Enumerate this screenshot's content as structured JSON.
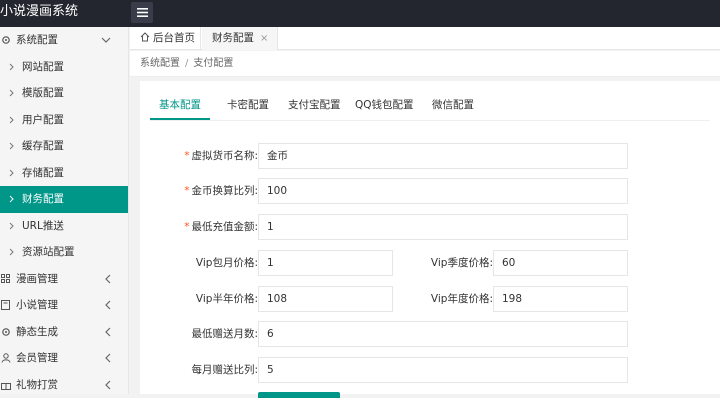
{
  "app": {
    "title": "小说漫画系统"
  },
  "sidebar": {
    "group_open": "系统配置",
    "subitems": [
      {
        "label": "网站配置"
      },
      {
        "label": "模版配置"
      },
      {
        "label": "用户配置"
      },
      {
        "label": "缓存配置"
      },
      {
        "label": "存储配置"
      },
      {
        "label": "财务配置"
      },
      {
        "label": "URL推送"
      },
      {
        "label": "资源站配置"
      }
    ],
    "groups": [
      {
        "label": "漫画管理"
      },
      {
        "label": "小说管理"
      },
      {
        "label": "静态生成"
      },
      {
        "label": "会员管理"
      },
      {
        "label": "礼物打赏"
      }
    ]
  },
  "tabs": {
    "home": "后台首页",
    "current": "财务配置",
    "close_glyph": "×"
  },
  "breadcrumb": {
    "parent": "系统配置",
    "separator": "/",
    "current": "支付配置"
  },
  "subtabs": [
    "基本配置",
    "卡密配置",
    "支付宝配置",
    "QQ钱包配置",
    "微信配置"
  ],
  "form": {
    "currency_name": {
      "label": "虚拟货币名称:",
      "value": "金币"
    },
    "exchange_ratio": {
      "label": "金币换算比列:",
      "value": "100"
    },
    "min_recharge": {
      "label": "最低充值金额:",
      "value": "1"
    },
    "vip_month": {
      "label": "Vip包月价格:",
      "value": "1"
    },
    "vip_quarter": {
      "label": "Vip季度价格:",
      "value": "60"
    },
    "vip_half_year": {
      "label": "Vip半年价格:",
      "value": "108"
    },
    "vip_year": {
      "label": "Vip年度价格:",
      "value": "198"
    },
    "min_gift_months": {
      "label": "最低赠送月数:",
      "value": "6"
    },
    "monthly_gift_ratio": {
      "label": "每月赠送比列:",
      "value": "5"
    },
    "required_mark": "*"
  },
  "colors": {
    "accent": "#009688",
    "topbar": "#23262e",
    "required": "#ff5722"
  }
}
